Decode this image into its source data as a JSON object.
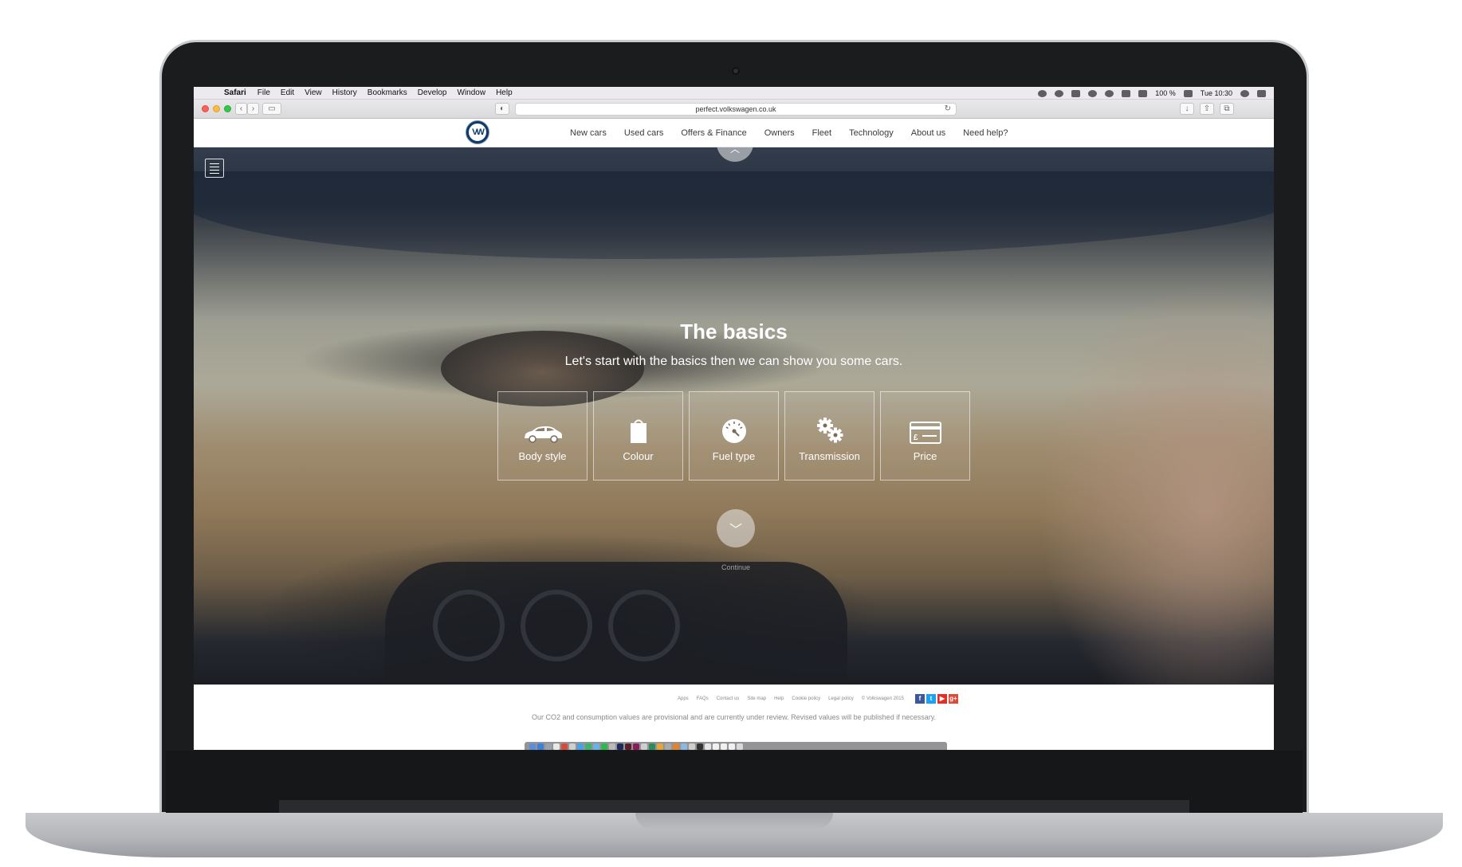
{
  "menubar": {
    "app": "Safari",
    "items": [
      "File",
      "Edit",
      "View",
      "History",
      "Bookmarks",
      "Develop",
      "Window",
      "Help"
    ],
    "battery": "100 %",
    "clock": "Tue 10:30"
  },
  "browser": {
    "url": "perfect.volkswagen.co.uk"
  },
  "site": {
    "logo_text": "VW",
    "nav": [
      "New cars",
      "Used cars",
      "Offers & Finance",
      "Owners",
      "Fleet",
      "Technology",
      "About us",
      "Need help?"
    ]
  },
  "hero": {
    "title": "The basics",
    "subtitle": "Let's start with the basics then we can show you some cars.",
    "options": [
      {
        "label": "Body style",
        "icon": "car-icon"
      },
      {
        "label": "Colour",
        "icon": "paint-can-icon"
      },
      {
        "label": "Fuel type",
        "icon": "fuel-gauge-icon"
      },
      {
        "label": "Transmission",
        "icon": "gears-icon"
      },
      {
        "label": "Price",
        "icon": "credit-card-icon"
      }
    ],
    "continue_label": "Continue"
  },
  "footer": {
    "links": [
      "Apps",
      "FAQs",
      "Contact us",
      "Site map",
      "Help",
      "Cookie policy",
      "Legal policy",
      "© Volkswagen 2015"
    ],
    "social": [
      {
        "icon": "facebook-icon",
        "glyph": "f",
        "color": "#3b5998"
      },
      {
        "icon": "twitter-icon",
        "glyph": "t",
        "color": "#1da1f2"
      },
      {
        "icon": "youtube-icon",
        "glyph": "▶",
        "color": "#e52d27"
      },
      {
        "icon": "google-plus-icon",
        "glyph": "g+",
        "color": "#dd4b39"
      }
    ],
    "disclaimer": "Our CO2 and consumption values are provisional and are currently under review. Revised values will be published if necessary."
  }
}
